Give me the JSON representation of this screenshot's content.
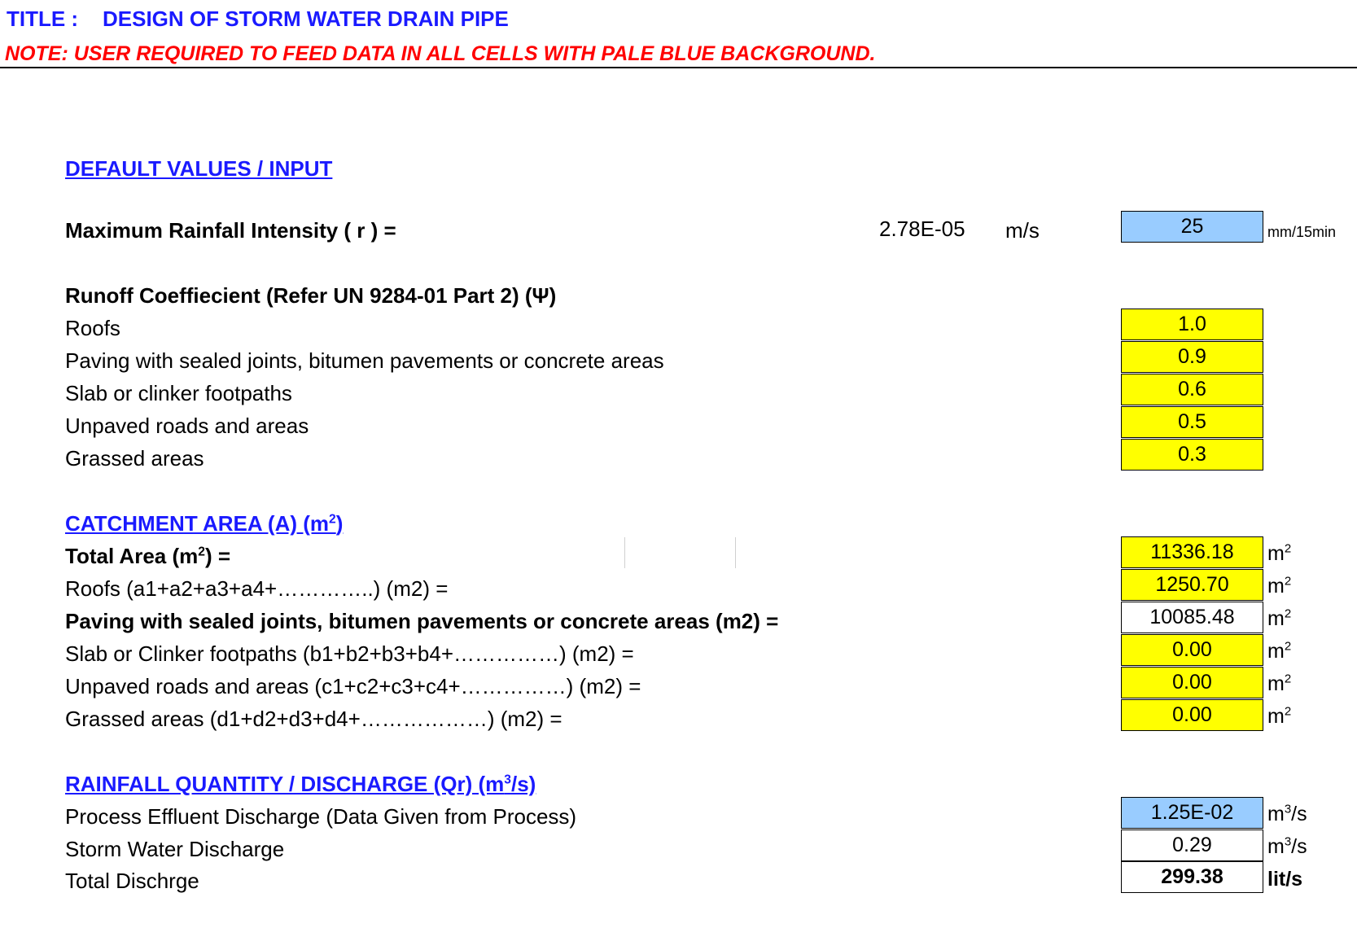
{
  "header": {
    "title_label": "TITLE :",
    "title": "DESIGN OF STORM WATER DRAIN PIPE",
    "note": "NOTE: USER REQUIRED TO FEED DATA IN ALL CELLS WITH PALE BLUE BACKGROUND."
  },
  "default_values": {
    "heading": "DEFAULT VALUES / INPUT",
    "rainfall": {
      "label": "Maximum Rainfall Intensity ( r ) =",
      "computed_value": "2.78E-05",
      "computed_unit": "m/s",
      "input_value": "25",
      "input_unit": "mm/15min"
    }
  },
  "runoff": {
    "heading": "Runoff Coeffiecient (Refer UN 9284-01 Part 2) (Ψ)",
    "items": [
      {
        "label": "Roofs",
        "value": "1.0"
      },
      {
        "label": "Paving with sealed joints, bitumen pavements or concrete areas",
        "value": "0.9"
      },
      {
        "label": "Slab or clinker footpaths",
        "value": "0.6"
      },
      {
        "label": "Unpaved roads and areas",
        "value": "0.5"
      },
      {
        "label": "Grassed areas",
        "value": "0.3"
      }
    ]
  },
  "catchment": {
    "heading": "CATCHMENT AREA (A) (m",
    "heading_sup": "2",
    "heading_end": ")",
    "total": {
      "label": "Total Area (m",
      "label_sup": "2",
      "label_end": ") =",
      "value": "11336.18",
      "unit": "m",
      "unit_sup": "2"
    },
    "items": [
      {
        "label": "Roofs (a1+a2+a3+a4+…………..) (m2) =",
        "value": "1250.70",
        "unit": "m",
        "unit_sup": "2"
      },
      {
        "label": "Paving with sealed joints, bitumen pavements or concrete areas (m2) =",
        "value": "10085.48",
        "unit": "m",
        "unit_sup": "2"
      },
      {
        "label": "Slab or Clinker footpaths (b1+b2+b3+b4+……………) (m2) =",
        "value": "0.00",
        "unit": "m",
        "unit_sup": "2"
      },
      {
        "label": "Unpaved roads and areas (c1+c2+c3+c4+……………) (m2) =",
        "value": "0.00",
        "unit": "m",
        "unit_sup": "2"
      },
      {
        "label": "Grassed areas (d1+d2+d3+d4+………………) (m2) =",
        "value": "0.00",
        "unit": "m",
        "unit_sup": "2"
      }
    ]
  },
  "discharge": {
    "heading": "RAINFALL QUANTITY / DISCHARGE (Qr) (m",
    "heading_sup": "3",
    "heading_end": "/s)",
    "items": [
      {
        "label": "Process Effluent Discharge (Data Given from Process)",
        "value": "1.25E-02",
        "unit": "m",
        "unit_sup": "3",
        "unit_end": "/s"
      },
      {
        "label": "Storm Water Discharge",
        "value": "0.29",
        "unit": "m",
        "unit_sup": "3",
        "unit_end": "/s"
      },
      {
        "label": "Total Dischrge",
        "value": "299.38",
        "unit": "lit/s"
      }
    ]
  },
  "colors": {
    "heading_blue": "#1a1aff",
    "note_red": "#ff0000",
    "input_blue": "#99ccff",
    "input_yellow": "#ffff00"
  }
}
